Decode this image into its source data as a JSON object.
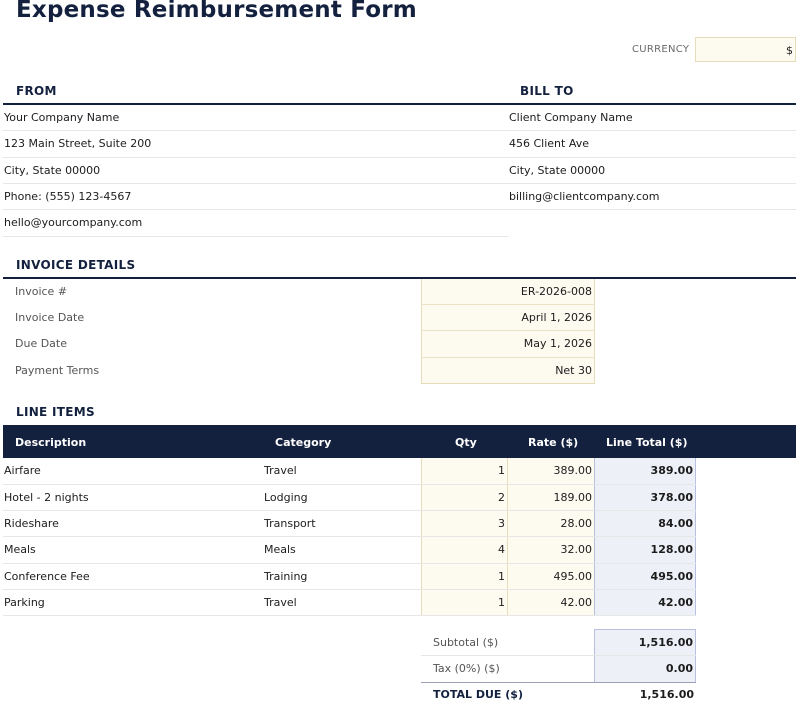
{
  "title": "Expense Reimbursement Form",
  "currency": {
    "label": "CURRENCY",
    "value": "$"
  },
  "from": {
    "heading": "FROM",
    "lines": [
      "Your Company Name",
      "123 Main Street, Suite 200",
      "City, State 00000",
      "Phone: (555) 123-4567",
      "hello@yourcompany.com"
    ]
  },
  "bill_to": {
    "heading": "BILL TO",
    "lines": [
      "Client Company Name",
      "456 Client Ave",
      "City, State 00000",
      "billing@clientcompany.com"
    ]
  },
  "invoice_details": {
    "heading": "INVOICE DETAILS",
    "rows": [
      {
        "label": "Invoice #",
        "value": "ER-2026-008"
      },
      {
        "label": "Invoice Date",
        "value": "April 1, 2026"
      },
      {
        "label": "Due Date",
        "value": "May 1, 2026"
      },
      {
        "label": "Payment Terms",
        "value": "Net 30"
      }
    ]
  },
  "line_items": {
    "heading": "LINE ITEMS",
    "columns": {
      "description": "Description",
      "category": "Category",
      "qty": "Qty",
      "rate": "Rate ($)",
      "total": "Line Total ($)"
    },
    "rows": [
      {
        "description": "Airfare",
        "category": "Travel",
        "qty": "1",
        "rate": "389.00",
        "total": "389.00"
      },
      {
        "description": "Hotel - 2 nights",
        "category": "Lodging",
        "qty": "2",
        "rate": "189.00",
        "total": "378.00"
      },
      {
        "description": "Rideshare",
        "category": "Transport",
        "qty": "3",
        "rate": "28.00",
        "total": "84.00"
      },
      {
        "description": "Meals",
        "category": "Meals",
        "qty": "4",
        "rate": "32.00",
        "total": "128.00"
      },
      {
        "description": "Conference Fee",
        "category": "Training",
        "qty": "1",
        "rate": "495.00",
        "total": "495.00"
      },
      {
        "description": "Parking",
        "category": "Travel",
        "qty": "1",
        "rate": "42.00",
        "total": "42.00"
      }
    ]
  },
  "summary": {
    "subtotal_label": "Subtotal ($)",
    "subtotal": "1,516.00",
    "tax_label": "Tax (0%) ($)",
    "tax": "0.00",
    "total_label": "TOTAL DUE ($)",
    "total": "1,516.00"
  },
  "colors": {
    "navy": "#13213f",
    "input_fill": "#fdfaf0",
    "total_fill": "#eef0f8"
  }
}
